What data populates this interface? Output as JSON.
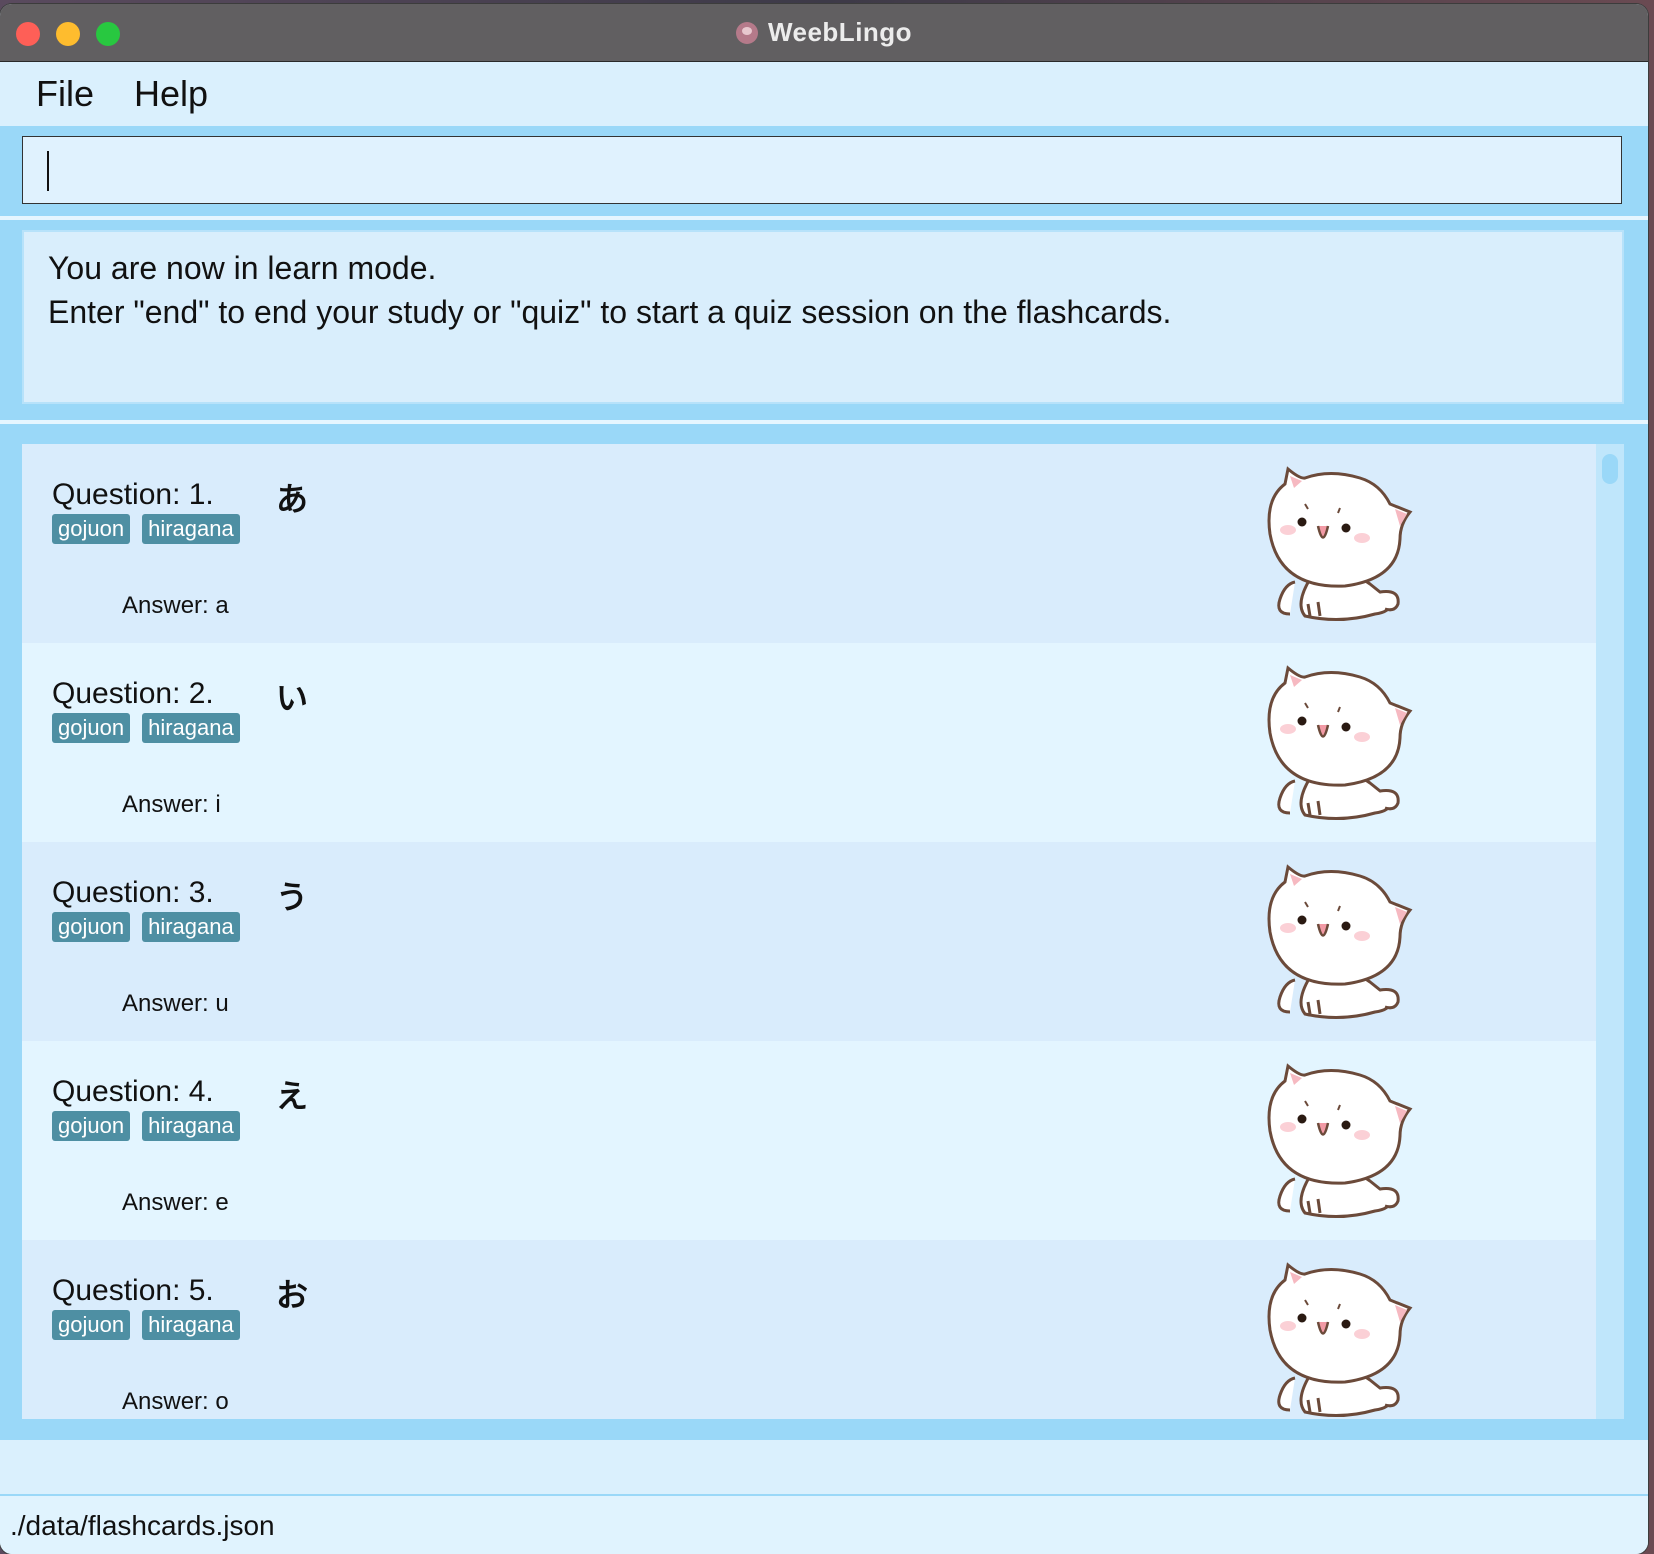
{
  "window": {
    "title": "WeebLingo"
  },
  "menu": {
    "file": "File",
    "help": "Help"
  },
  "command": {
    "value": ""
  },
  "result": {
    "line1": "You are now in learn mode.",
    "line2": "Enter \"end\" to end your study or \"quiz\" to start a quiz session on the flashcards."
  },
  "cards": [
    {
      "question": "Question: 1.",
      "char": "あ",
      "tags": [
        "gojuon",
        "hiragana"
      ],
      "answer": "Answer: a"
    },
    {
      "question": "Question: 2.",
      "char": "い",
      "tags": [
        "gojuon",
        "hiragana"
      ],
      "answer": "Answer: i"
    },
    {
      "question": "Question: 3.",
      "char": "う",
      "tags": [
        "gojuon",
        "hiragana"
      ],
      "answer": "Answer: u"
    },
    {
      "question": "Question: 4.",
      "char": "え",
      "tags": [
        "gojuon",
        "hiragana"
      ],
      "answer": "Answer: e"
    },
    {
      "question": "Question: 5.",
      "char": "お",
      "tags": [
        "gojuon",
        "hiragana"
      ],
      "answer": "Answer: o"
    }
  ],
  "status": {
    "path": "./data/flashcards.json"
  },
  "colors": {
    "tag_bg": "#4e8fa3",
    "panel_bg": "#9ad8f8",
    "card_odd": "#d9ecfc",
    "card_even": "#e3f5ff"
  }
}
